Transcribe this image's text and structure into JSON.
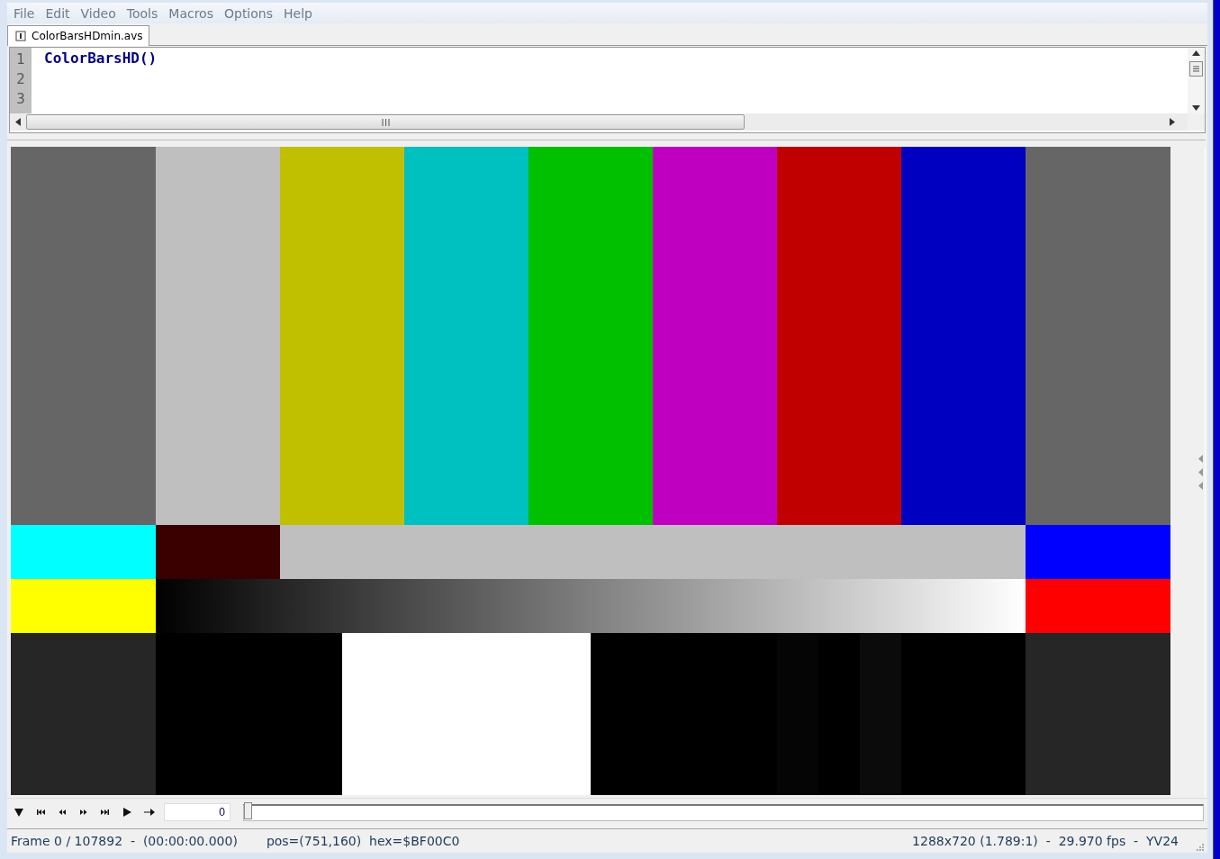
{
  "menu": [
    "File",
    "Edit",
    "Video",
    "Tools",
    "Macros",
    "Options",
    "Help"
  ],
  "tabs": [
    {
      "label": "ColorBarsHDmin.avs",
      "selected": true
    }
  ],
  "editor": {
    "line_numbers": [
      "1",
      "2",
      "3"
    ],
    "lines": [
      "ColorBarsHD()"
    ]
  },
  "playback": {
    "frame_value": "0",
    "slider": {
      "level": 0
    }
  },
  "status_bar": {
    "frame": "Frame 0 / 107892  -  (00:00:00.000)",
    "pixel": "pos=(751,160)  hex=$BF00C0",
    "video_info": "1288x720 (1.789:1)  -  29.970 fps  -  YV24"
  }
}
